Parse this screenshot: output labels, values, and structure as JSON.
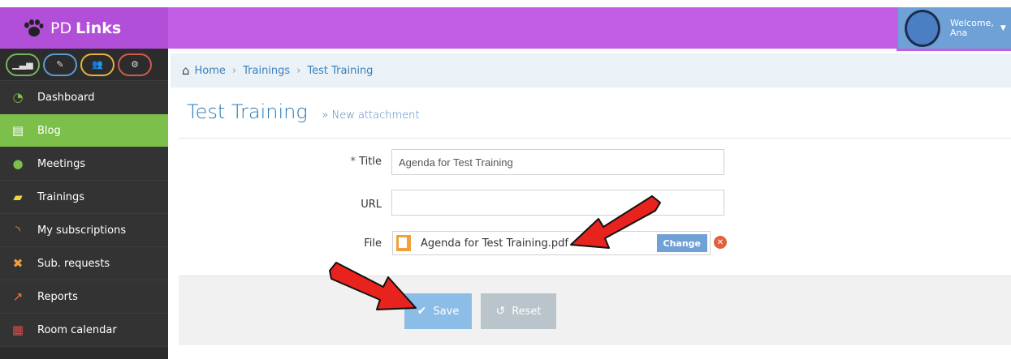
{
  "app": {
    "brand_pd": "PD",
    "brand_links": "Links"
  },
  "user": {
    "welcome": "Welcome,",
    "name": "Ana"
  },
  "shortcuts": [
    {
      "icon": "signal-icon",
      "glyph": "▁▃▅"
    },
    {
      "icon": "pencil-icon",
      "glyph": "✎"
    },
    {
      "icon": "group-icon",
      "glyph": "👥"
    },
    {
      "icon": "cogs-icon",
      "glyph": "⚙"
    }
  ],
  "sidebar": {
    "items": [
      {
        "label": "Dashboard",
        "icon": "dashboard-icon",
        "glyph": "◔",
        "color": "#7cbf4a"
      },
      {
        "label": "Blog",
        "icon": "newspaper-icon",
        "glyph": "▤",
        "color": "#ffffff"
      },
      {
        "label": "Meetings",
        "icon": "group-icon",
        "glyph": "●",
        "color": "#7cbf4a"
      },
      {
        "label": "Trainings",
        "icon": "book-icon",
        "glyph": "▰",
        "color": "#f2d63a"
      },
      {
        "label": "My subscriptions",
        "icon": "rss-icon",
        "glyph": "◝",
        "color": "#f0a23a"
      },
      {
        "label": "Sub. requests",
        "icon": "user-remove-icon",
        "glyph": "✖",
        "color": "#f0a23a"
      },
      {
        "label": "Reports",
        "icon": "chart-line-icon",
        "glyph": "↗",
        "color": "#f07a3a"
      },
      {
        "label": "Room calendar",
        "icon": "calendar-icon",
        "glyph": "▦",
        "color": "#e04a4a"
      }
    ]
  },
  "breadcrumb": {
    "home": "Home",
    "trainings": "Trainings",
    "current": "Test Training",
    "separator": "›"
  },
  "page": {
    "title": "Test Training",
    "subtitle": "» New attachment"
  },
  "form": {
    "title_required": "*",
    "title_label": "Title",
    "title_value": "Agenda for Test Training",
    "url_label": "URL",
    "url_value": "",
    "file_label": "File",
    "file_name": "Agenda for Test Training.pdf",
    "change_label": "Change"
  },
  "actions": {
    "save_label": "Save",
    "reset_label": "Reset"
  }
}
